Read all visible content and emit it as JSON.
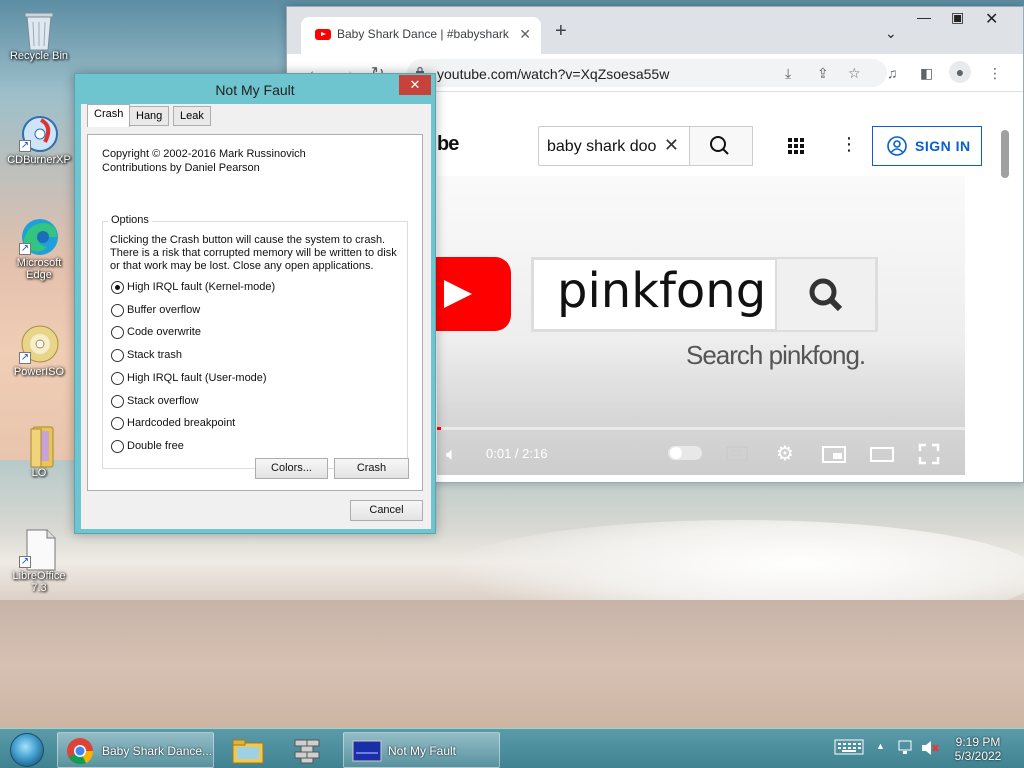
{
  "desktop": {
    "icons": [
      {
        "label": "Recycle Bin"
      },
      {
        "label": "CDBurnerXP"
      },
      {
        "label": "Microsoft Edge"
      },
      {
        "label": "PowerISO"
      },
      {
        "label": "LO"
      },
      {
        "label": "LibreOffice 7.3"
      }
    ]
  },
  "browser": {
    "tab_title": "Baby Shark Dance | #babyshark",
    "url": "youtube.com/watch?v=XqZsoesa55w",
    "logo_fragment": "be",
    "search_value": "baby shark doo",
    "sign_in": "SIGN IN",
    "video": {
      "pinkfong_text": "pinkfong",
      "subtitle": "Search pinkfong.",
      "time": "0:01 / 2:16",
      "progress_fraction": 0.008
    }
  },
  "dialog": {
    "title": "Not My Fault",
    "tabs": [
      "Crash",
      "Hang",
      "Leak"
    ],
    "active_tab": "Crash",
    "copyright": "Copyright © 2002-2016 Mark Russinovich",
    "contributions": "Contributions by Daniel Pearson",
    "options_label": "Options",
    "description": [
      "Clicking the Crash button will cause the system to crash.",
      "There is a risk that corrupted memory will be written to disk",
      "or that work may be lost. Close any open applications."
    ],
    "options": [
      "High IRQL fault (Kernel-mode)",
      "Buffer overflow",
      "Code overwrite",
      "Stack trash",
      "High IRQL fault (User-mode)",
      "Stack overflow",
      "Hardcoded breakpoint",
      "Double free"
    ],
    "selected_option": "High IRQL fault (Kernel-mode)",
    "colors_button": "Colors...",
    "crash_button": "Crash",
    "cancel_button": "Cancel"
  },
  "taskbar": {
    "items": [
      {
        "label": "Baby Shark Dance..."
      },
      {
        "label": ""
      },
      {
        "label": ""
      },
      {
        "label": "Not My Fault"
      }
    ],
    "time": "9:19 PM",
    "date": "5/3/2022"
  }
}
